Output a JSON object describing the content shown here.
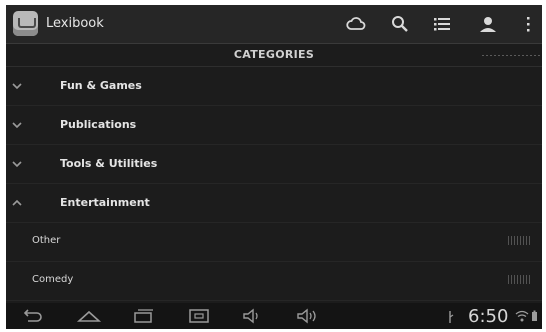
{
  "app": {
    "title": "Lexibook"
  },
  "header": {
    "title": "CATEGORIES"
  },
  "categories": [
    {
      "label": "Fun & Games",
      "expanded": false
    },
    {
      "label": "Publications",
      "expanded": false
    },
    {
      "label": "Tools & Utilities",
      "expanded": false
    },
    {
      "label": "Entertainment",
      "expanded": true
    }
  ],
  "subcategories": [
    {
      "label": "Other"
    },
    {
      "label": "Comedy"
    }
  ],
  "actionbar_icons": [
    "cloud-icon",
    "search-icon",
    "list-icon",
    "account-icon",
    "overflow-menu-icon"
  ],
  "navbar": {
    "buttons": [
      "back-icon",
      "home-icon",
      "recents-icon",
      "screenshot-icon",
      "volume-down-icon",
      "volume-up-icon"
    ],
    "time": "6:50"
  },
  "colors": {
    "background": "#1c1c1c",
    "actionbar": "#262626",
    "text": "#e4e4e4"
  }
}
